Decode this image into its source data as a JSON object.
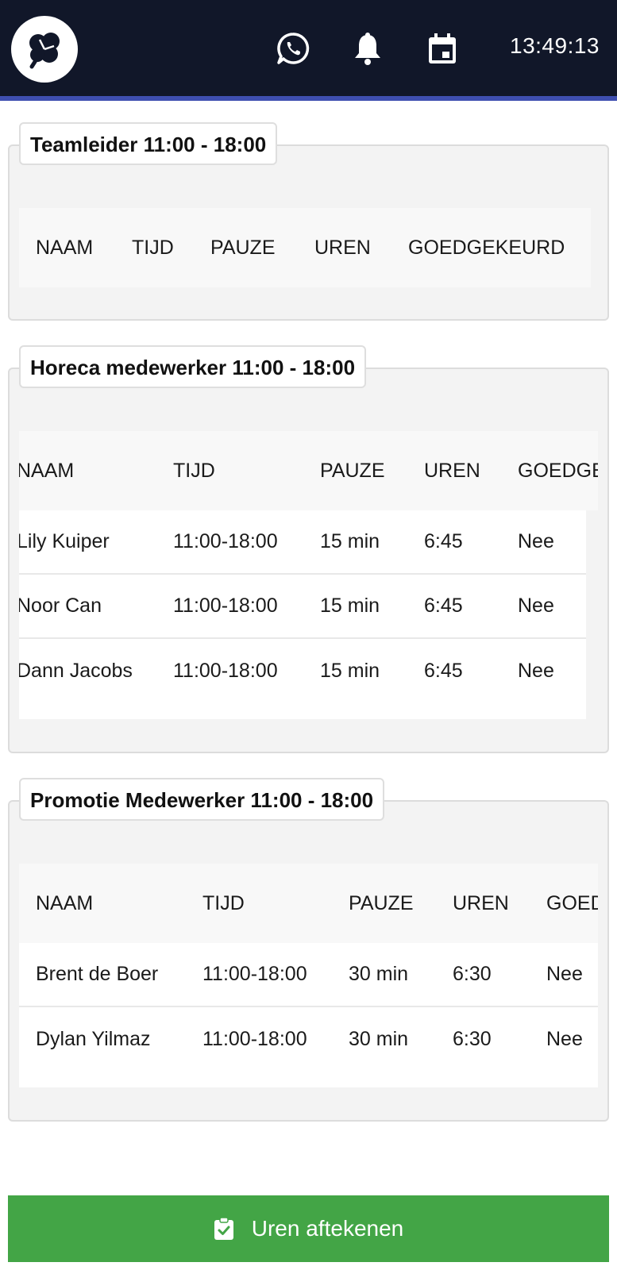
{
  "header": {
    "time": "13:49:13",
    "icons": [
      "clover-logo-icon",
      "whatsapp-icon",
      "bell-icon",
      "calendar-icon"
    ]
  },
  "sections": [
    {
      "title": "Teamleider 11:00 - 18:00",
      "columns": [
        "NAAM",
        "TIJD",
        "PAUZE",
        "UREN",
        "GOEDGEKEURD"
      ],
      "rows": []
    },
    {
      "title": "Horeca medewerker 11:00 - 18:00",
      "columns": [
        "NAAM",
        "TIJD",
        "PAUZE",
        "UREN",
        "GOEDGEKEURD"
      ],
      "rows": [
        [
          "Lily Kuiper",
          "11:00-18:00",
          "15 min",
          "6:45",
          "Nee"
        ],
        [
          "Noor Can",
          "11:00-18:00",
          "15 min",
          "6:45",
          "Nee"
        ],
        [
          "Dann Jacobs",
          "11:00-18:00",
          "15 min",
          "6:45",
          "Nee"
        ]
      ]
    },
    {
      "title": "Promotie Medewerker 11:00 - 18:00",
      "columns": [
        "NAAM",
        "TIJD",
        "PAUZE",
        "UREN",
        "GOEDGEKEURD"
      ],
      "rows": [
        [
          "Brent de Boer",
          "11:00-18:00",
          "30 min",
          "6:30",
          "Nee"
        ],
        [
          "Dylan Yilmaz",
          "11:00-18:00",
          "30 min",
          "6:30",
          "Nee"
        ]
      ]
    }
  ],
  "actions": {
    "submit_label": "Uren aftekenen",
    "submit_icon": "clipboard-check-icon"
  },
  "colors": {
    "header_bg": "#111729",
    "header_accent": "#3f4fb0",
    "submit_bg": "#43a546"
  }
}
